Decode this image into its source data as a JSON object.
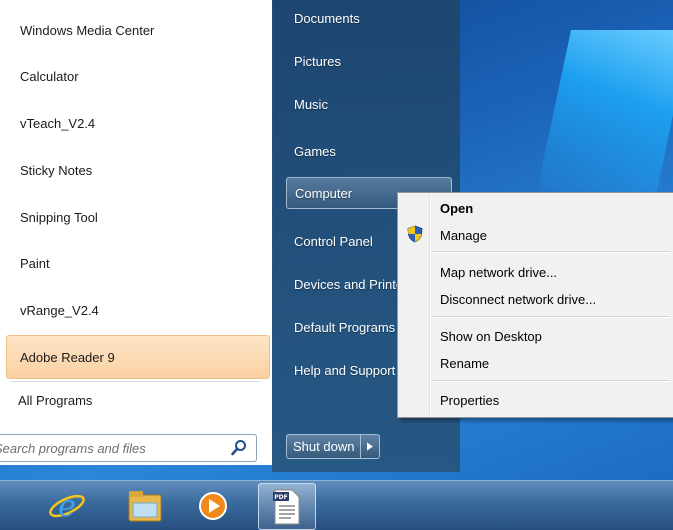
{
  "programs": [
    {
      "label": "Windows Media Center"
    },
    {
      "label": "Calculator"
    },
    {
      "label": "vTeach_V2.4"
    },
    {
      "label": "Sticky Notes"
    },
    {
      "label": "Snipping Tool"
    },
    {
      "label": "Paint"
    },
    {
      "label": "vRange_V2.4"
    },
    {
      "label": "Adobe Reader 9"
    }
  ],
  "all_programs_label": "All Programs",
  "search": {
    "placeholder": "Search programs and files"
  },
  "right_items": [
    {
      "label": "Documents"
    },
    {
      "label": "Pictures"
    },
    {
      "label": "Music"
    },
    {
      "label": "Games"
    },
    {
      "label": "Computer"
    },
    {
      "label": "Control Panel"
    },
    {
      "label": "Devices and Printers"
    },
    {
      "label": "Default Programs"
    },
    {
      "label": "Help and Support"
    }
  ],
  "shutdown": {
    "label": "Shut down"
  },
  "context_menu": {
    "open": "Open",
    "manage": "Manage",
    "map_drive": "Map network drive...",
    "disconnect_drive": "Disconnect network drive...",
    "show_desktop": "Show on Desktop",
    "rename": "Rename",
    "properties": "Properties"
  },
  "taskbar": {
    "pdf_badge": "PDF"
  },
  "colors": {
    "highlight": "#fbd1a2",
    "right_pane": "#1f4a73",
    "taskbar": "#3a6a9c"
  }
}
